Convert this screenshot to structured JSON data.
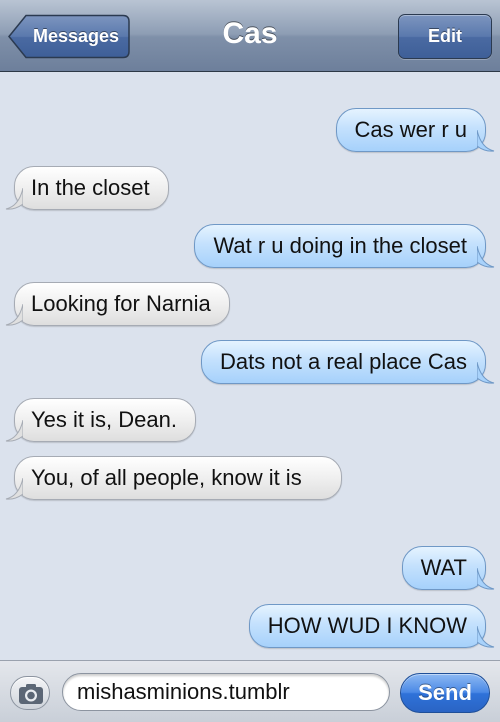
{
  "navbar": {
    "back_label": "Messages",
    "title": "Cas",
    "edit_label": "Edit"
  },
  "messages": [
    {
      "from": "me",
      "text": "Cas wer r u"
    },
    {
      "from": "them",
      "text": "In the closet"
    },
    {
      "from": "me",
      "text": "Wat r u doing in the closet"
    },
    {
      "from": "them",
      "text": "Looking for Narnia"
    },
    {
      "from": "me",
      "text": "Dats not a real place Cas"
    },
    {
      "from": "them",
      "text": "Yes it is, Dean."
    },
    {
      "from": "them",
      "text": "You, of all people, know it is"
    },
    {
      "from": "me",
      "text": "WAT"
    },
    {
      "from": "me",
      "text": "HOW WUD I KNOW"
    }
  ],
  "input": {
    "value": "mishasminions.tumblr",
    "camera_icon": "camera-icon",
    "send_label": "Send"
  },
  "colors": {
    "outgoing_bubble": "#b5d9fc",
    "incoming_bubble": "#ececec",
    "background": "#dbe2ed",
    "send_button": "#2f72d9"
  }
}
